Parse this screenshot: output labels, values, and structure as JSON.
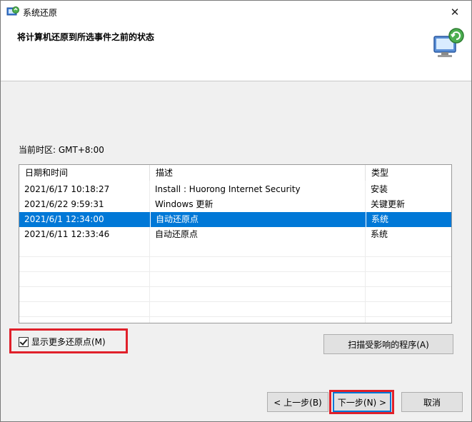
{
  "window": {
    "title": "系统还原",
    "close_glyph": "✕",
    "header_title": "将计算机还原到所选事件之前的状态"
  },
  "timezone_label": "当前时区: GMT+8:00",
  "list": {
    "columns": [
      "日期和时间",
      "描述",
      "类型"
    ],
    "sort_indicator": "^",
    "rows": [
      {
        "date": "2021/6/17 10:18:27",
        "desc": "Install : Huorong Internet Security",
        "type": "安装"
      },
      {
        "date": "2021/6/22 9:59:31",
        "desc": "Windows 更新",
        "type": "关键更新"
      },
      {
        "date": "2021/6/1 12:34:00",
        "desc": "自动还原点",
        "type": "系统"
      },
      {
        "date": "2021/6/11 12:33:46",
        "desc": "自动还原点",
        "type": "系统"
      }
    ],
    "selected_index": 2
  },
  "show_more_checkbox": {
    "label": "显示更多还原点(M)",
    "checked": true
  },
  "scan_button_label": "扫描受影响的程序(A)",
  "buttons": {
    "back": "< 上一步(B)",
    "next": "下一步(N) >",
    "cancel": "取消"
  },
  "colors": {
    "selection": "#0078d7",
    "highlight_box": "#e0202a"
  }
}
